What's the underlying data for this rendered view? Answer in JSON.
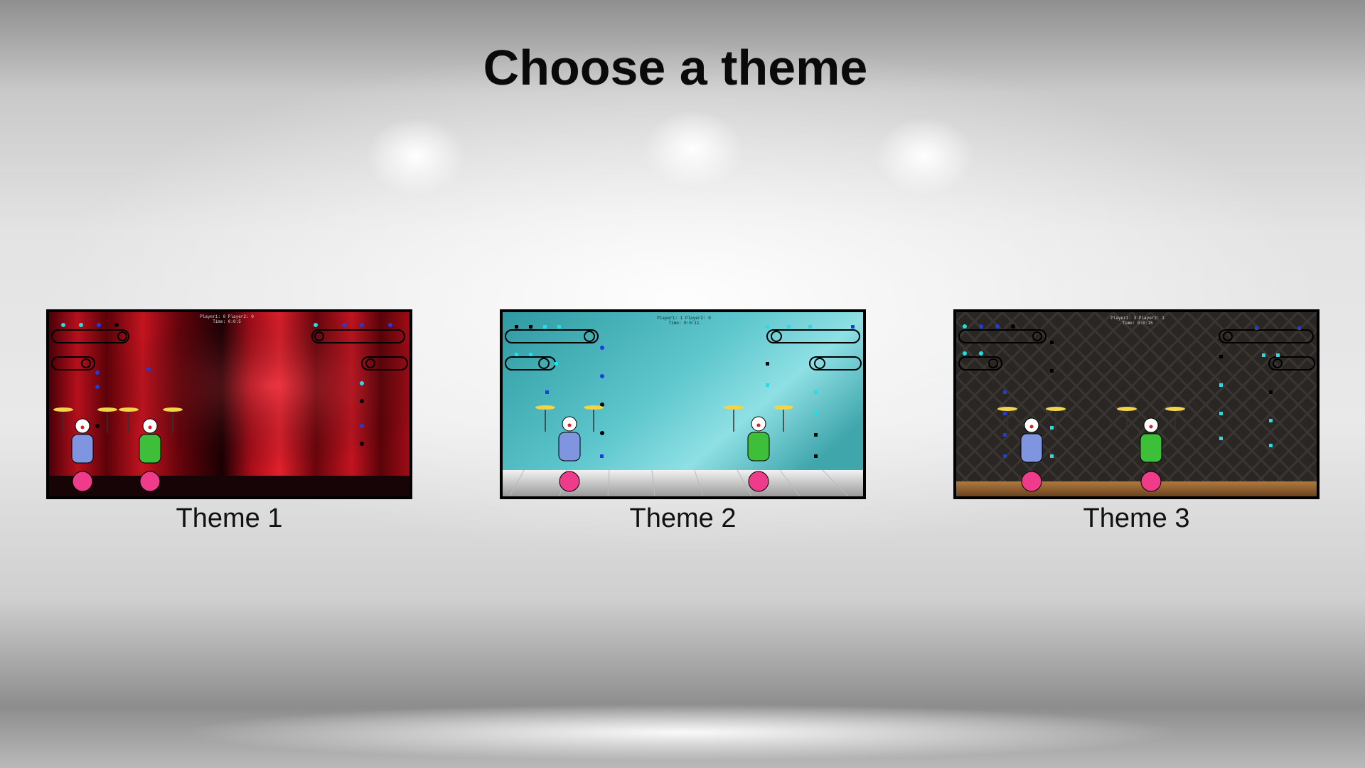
{
  "title": "Choose a theme",
  "themes": [
    {
      "label": "Theme 1",
      "hud_scores": "Player1: 0 Player2: 0",
      "hud_time": "Time: 0:0:5",
      "background": "red-curtain",
      "colors": {
        "primary": "#b0101a",
        "dark": "#3a0006",
        "floor": "#1a0608"
      }
    },
    {
      "label": "Theme 2",
      "hud_scores": "Player1: 1 Player2: 0",
      "hud_time": "Time: 0:0:11",
      "background": "teal-room",
      "colors": {
        "primary": "#4fb7bd",
        "dark": "#1e7b82",
        "floor": "#e4e4e4"
      }
    },
    {
      "label": "Theme 3",
      "hud_scores": "Player1: 3 Player2: 1",
      "hud_time": "Time: 0:0:15",
      "background": "dark-wallpaper",
      "colors": {
        "primary": "#2b2724",
        "dark": "#151210",
        "floor": "#8a5a2c"
      }
    }
  ]
}
